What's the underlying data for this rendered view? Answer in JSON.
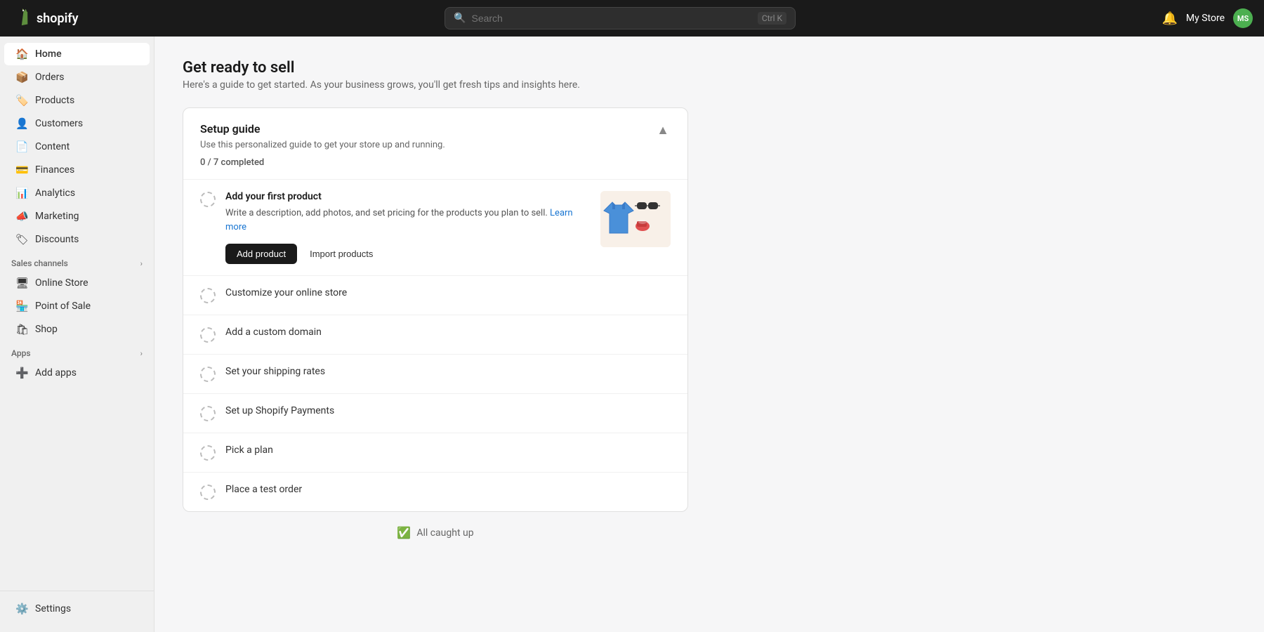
{
  "topnav": {
    "logo_text": "shopify",
    "search_placeholder": "Search",
    "search_shortcut": "Ctrl K",
    "bell_icon": "bell",
    "store_name": "My Store",
    "avatar_initials": "MS"
  },
  "sidebar": {
    "main_items": [
      {
        "id": "home",
        "label": "Home",
        "icon": "🏠",
        "active": true
      },
      {
        "id": "orders",
        "label": "Orders",
        "icon": "📦"
      },
      {
        "id": "products",
        "label": "Products",
        "icon": "🏷️"
      },
      {
        "id": "customers",
        "label": "Customers",
        "icon": "👤"
      },
      {
        "id": "content",
        "label": "Content",
        "icon": "📄"
      },
      {
        "id": "finances",
        "label": "Finances",
        "icon": "💳"
      },
      {
        "id": "analytics",
        "label": "Analytics",
        "icon": "📊"
      },
      {
        "id": "marketing",
        "label": "Marketing",
        "icon": "📣"
      },
      {
        "id": "discounts",
        "label": "Discounts",
        "icon": "🏷"
      }
    ],
    "sales_channels_label": "Sales channels",
    "sales_channels": [
      {
        "id": "online-store",
        "label": "Online Store",
        "icon": "🖥"
      },
      {
        "id": "point-of-sale",
        "label": "Point of Sale",
        "icon": "🏪"
      },
      {
        "id": "shop",
        "label": "Shop",
        "icon": "🛍"
      }
    ],
    "apps_label": "Apps",
    "apps_items": [
      {
        "id": "add-apps",
        "label": "Add apps",
        "icon": "➕"
      }
    ],
    "bottom_items": [
      {
        "id": "settings",
        "label": "Settings",
        "icon": "⚙️"
      }
    ]
  },
  "main": {
    "page_title": "Get ready to sell",
    "page_subtitle": "Here's a guide to get started. As your business grows, you'll get fresh tips and insights here.",
    "setup_guide": {
      "title": "Setup guide",
      "description": "Use this personalized guide to get your store up and running.",
      "progress": "0 / 7",
      "completed_label": "completed",
      "collapse_icon": "▲",
      "tasks": [
        {
          "id": "add-first-product",
          "title": "Add your first product",
          "description": "Write a description, add photos, and set pricing for the products you plan to sell.",
          "link_text": "Learn more",
          "primary_action": "Add product",
          "secondary_action": "Import products",
          "expanded": true,
          "completed": false
        },
        {
          "id": "customize-store",
          "title": "Customize your online store",
          "expanded": false,
          "completed": false
        },
        {
          "id": "add-domain",
          "title": "Add a custom domain",
          "expanded": false,
          "completed": false
        },
        {
          "id": "shipping-rates",
          "title": "Set your shipping rates",
          "expanded": false,
          "completed": false
        },
        {
          "id": "shopify-payments",
          "title": "Set up Shopify Payments",
          "expanded": false,
          "completed": false
        },
        {
          "id": "pick-plan",
          "title": "Pick a plan",
          "expanded": false,
          "completed": false
        },
        {
          "id": "test-order",
          "title": "Place a test order",
          "expanded": false,
          "completed": false
        }
      ]
    },
    "all_caught_up": "All caught up"
  }
}
